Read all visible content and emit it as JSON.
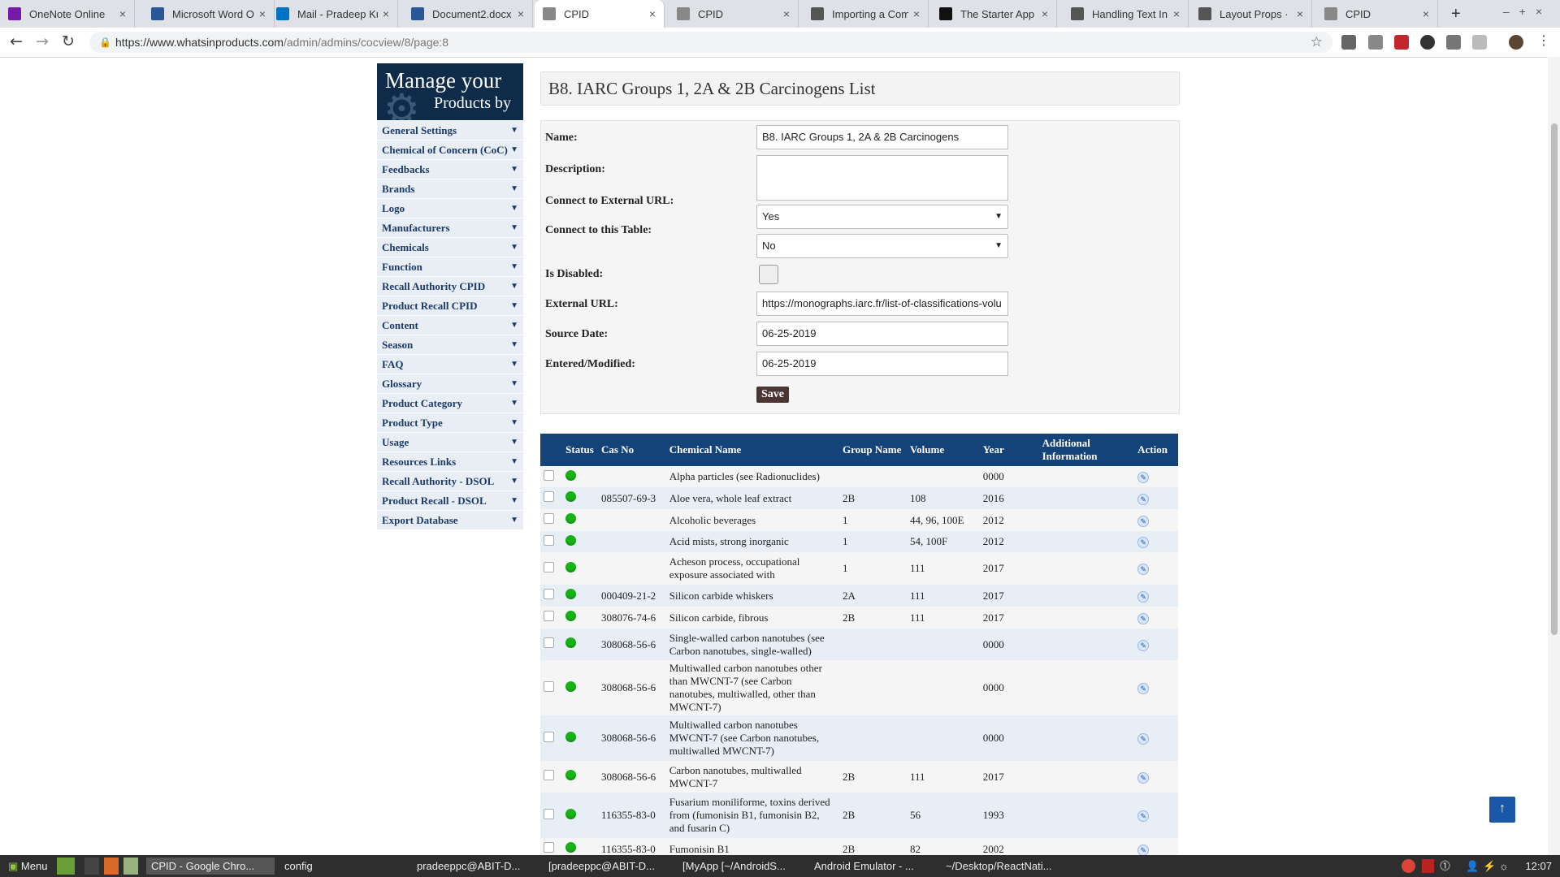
{
  "browser": {
    "tabs": [
      {
        "title": "OneNote Online",
        "icon": "onenote-icon",
        "color": "#7719aa"
      },
      {
        "title": "Microsoft Word O",
        "icon": "word-icon",
        "color": "#2b579a"
      },
      {
        "title": "Mail - Pradeep Ku",
        "icon": "outlook-icon",
        "color": "#0072c6"
      },
      {
        "title": "Document2.docx",
        "icon": "word-icon",
        "color": "#2b579a"
      },
      {
        "title": "CPID",
        "icon": "page-icon",
        "color": "#888888"
      },
      {
        "title": "CPID",
        "icon": "page-icon",
        "color": "#888888"
      },
      {
        "title": "Importing a Com",
        "icon": "generic-icon",
        "color": "#555555"
      },
      {
        "title": "The Starter App",
        "icon": "medium-icon",
        "color": "#111111"
      },
      {
        "title": "Handling Text In",
        "icon": "generic-icon",
        "color": "#555555"
      },
      {
        "title": "Layout Props · Re",
        "icon": "generic-icon",
        "color": "#555555"
      },
      {
        "title": "CPID",
        "icon": "page-icon",
        "color": "#888888"
      }
    ],
    "active_tab": 4,
    "url_host": "https://www.whatsinproducts.com",
    "url_path": "/admin/admins/cocview/8/page:8"
  },
  "logo": {
    "line1": "Manage your",
    "line2": "Products by"
  },
  "sidebar": {
    "items": [
      "General Settings",
      "Chemical of Concern (CoC)",
      "Feedbacks",
      "Brands",
      "Logo",
      "Manufacturers",
      "Chemicals",
      "Function",
      "Recall Authority CPID",
      "Product Recall CPID",
      "Content",
      "Season",
      "FAQ",
      "Glossary",
      "Product Category",
      "Product Type",
      "Usage",
      "Resources Links",
      "Recall Authority - DSOL",
      "Product Recall - DSOL",
      "Export Database"
    ]
  },
  "page": {
    "title": "B8. IARC Groups 1, 2A & 2B Carcinogens List"
  },
  "form": {
    "name_label": "Name:",
    "name_value": "B8. IARC Groups 1, 2A & 2B Carcinogens",
    "description_label": "Description:",
    "connect_external_label": "Connect to External URL:",
    "connect_external_value": "Yes",
    "connect_table_label": "Connect to this Table:",
    "connect_table_value": "No",
    "disabled_label": "Is Disabled:",
    "external_url_label": "External URL:",
    "external_url_value": "https://monographs.iarc.fr/list-of-classifications-volu",
    "source_date_label": "Source Date:",
    "source_date_value": "06-25-2019",
    "entered_label": "Entered/Modified:",
    "entered_value": "06-25-2019",
    "save_label": "Save"
  },
  "table": {
    "headers": [
      "",
      "Status",
      "Cas No",
      "Chemical Name",
      "Group Name",
      "Volume",
      "Year",
      "Additional Information",
      "Action"
    ],
    "rows": [
      {
        "cas": "",
        "name": "Alpha particles (see Radionuclides)",
        "group": "",
        "volume": "",
        "year": "0000"
      },
      {
        "cas": "085507-69-3",
        "name": "Aloe vera, whole leaf extract",
        "group": "2B",
        "volume": "108",
        "year": "2016"
      },
      {
        "cas": "",
        "name": "Alcoholic beverages",
        "group": "1",
        "volume": "44, 96, 100E",
        "year": "2012"
      },
      {
        "cas": "",
        "name": "Acid mists, strong inorganic",
        "group": "1",
        "volume": "54, 100F",
        "year": "2012"
      },
      {
        "cas": "",
        "name": "Acheson process, occupational exposure associated with",
        "group": "1",
        "volume": "111",
        "year": "2017"
      },
      {
        "cas": "000409-21-2",
        "name": "Silicon carbide whiskers",
        "group": "2A",
        "volume": "111",
        "year": "2017"
      },
      {
        "cas": "308076-74-6",
        "name": "Silicon carbide, fibrous",
        "group": "2B",
        "volume": "111",
        "year": "2017"
      },
      {
        "cas": "308068-56-6",
        "name": "Single-walled carbon nanotubes (see Carbon nanotubes, single-walled)",
        "group": "",
        "volume": "",
        "year": "0000"
      },
      {
        "cas": "308068-56-6",
        "name": "Multiwalled carbon nanotubes other than MWCNT-7 (see Carbon nanotubes, multiwalled, other than MWCNT-7)",
        "group": "",
        "volume": "",
        "year": "0000"
      },
      {
        "cas": "308068-56-6",
        "name": "Multiwalled carbon nanotubes MWCNT-7 (see Carbon nanotubes, multiwalled MWCNT-7)",
        "group": "",
        "volume": "",
        "year": "0000"
      },
      {
        "cas": "308068-56-6",
        "name": "Carbon nanotubes, multiwalled MWCNT-7",
        "group": "2B",
        "volume": "111",
        "year": "2017"
      },
      {
        "cas": "116355-83-0",
        "name": "Fusarium moniliforme, toxins derived from (fumonisin B1, fumonisin B2, and fusarin C)",
        "group": "2B",
        "volume": "56",
        "year": "1993"
      },
      {
        "cas": "116355-83-0",
        "name": "Fumonisin B1",
        "group": "2B",
        "volume": "82",
        "year": "2002"
      }
    ]
  },
  "taskbar": {
    "menu_label": "Menu",
    "items": [
      "CPID - Google Chro...",
      "config",
      "pradeeppc@ABIT-D...",
      "[pradeeppc@ABIT-D...",
      "[MyApp [~/AndroidS...",
      "Android Emulator - ...",
      "~/Desktop/ReactNati..."
    ],
    "clock": "12:07"
  }
}
